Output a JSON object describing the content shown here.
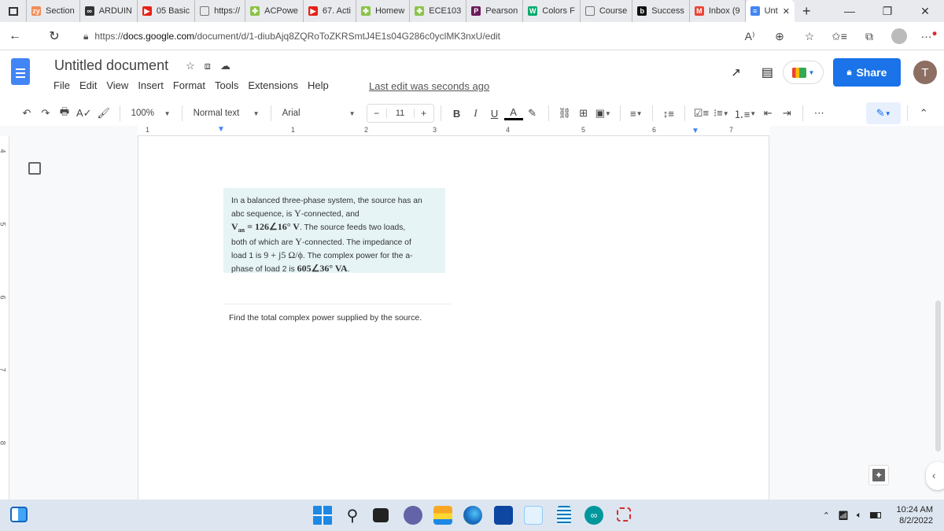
{
  "browser": {
    "tabs": [
      {
        "label": "Section",
        "icon": "zybooks-icon",
        "color": "#f28b57",
        "glyph": "zy"
      },
      {
        "label": "ARDUIN",
        "icon": "arduino-icon",
        "color": "#333333",
        "glyph": "∞"
      },
      {
        "label": "05 Basic",
        "icon": "youtube-icon",
        "color": "#e62117",
        "glyph": "▶"
      },
      {
        "label": "https://",
        "icon": "page-icon",
        "color": "#ffffff",
        "glyph": ""
      },
      {
        "label": "ACPowe",
        "icon": "chegg-icon",
        "color": "#8bc34a",
        "glyph": "✤"
      },
      {
        "label": "67. Acti",
        "icon": "youtube-icon",
        "color": "#e62117",
        "glyph": "▶"
      },
      {
        "label": "Homew",
        "icon": "chegg-icon",
        "color": "#8bc34a",
        "glyph": "✤"
      },
      {
        "label": "ECE103",
        "icon": "chegg-icon",
        "color": "#8bc34a",
        "glyph": "✤"
      },
      {
        "label": "Pearson",
        "icon": "pearson-icon",
        "color": "#6a1b5a",
        "glyph": "P"
      },
      {
        "label": "Colors F",
        "icon": "w3schools-icon",
        "color": "#04aa6d",
        "glyph": "W"
      },
      {
        "label": "Course",
        "icon": "course-icon",
        "color": "#888888",
        "glyph": ""
      },
      {
        "label": "Success",
        "icon": "bing-icon",
        "color": "#111111",
        "glyph": "b"
      },
      {
        "label": "Inbox (9",
        "icon": "gmail-icon",
        "color": "#ea4335",
        "glyph": "M"
      },
      {
        "label": "Unt",
        "icon": "docs-icon",
        "color": "#4285f4",
        "glyph": "≡",
        "active": true
      }
    ],
    "new_tab": "+",
    "url_prefix": "https://",
    "url_domain": "docs.google.com",
    "url_path": "/document/d/1-diubAjq8ZQRoToZKRSmtJ4E1s04G286c0yclMK3nxU/edit"
  },
  "docs": {
    "title": "Untitled document",
    "menu": [
      "File",
      "Edit",
      "View",
      "Insert",
      "Format",
      "Tools",
      "Extensions",
      "Help"
    ],
    "last_edit": "Last edit was seconds ago",
    "share_label": "Share",
    "user_initial": "T",
    "zoom": "100%",
    "style": "Normal text",
    "font": "Arial",
    "font_size": "11",
    "ruler_labels": [
      "1",
      "1",
      "2",
      "3",
      "4",
      "5",
      "6",
      "7"
    ],
    "vruler_labels": [
      "4",
      "5",
      "6",
      "7",
      "8"
    ]
  },
  "content": {
    "q1": "In a balanced three-phase system, the source has an",
    "q2a": "abc sequence, is ",
    "q2m": "Y",
    "q2b": "-connected, and",
    "q3m": "V",
    "q3sub": "an",
    "q3eq": " = 126∠16° V",
    "q3b": ". The source feeds two loads,",
    "q4a": "both of which are ",
    "q4m": "Y",
    "q4b": "-connected. The impedance of",
    "q5a": "load 1 is ",
    "q5m": "9 + j5 Ω/ϕ",
    "q5b": ". The complex power for the a-",
    "q6a": "phase of load 2 is ",
    "q6m": "605∠36° VA",
    "q6b": ".",
    "find": "Find the total complex power supplied by the source."
  },
  "taskbar": {
    "time": "10:24 AM",
    "date": "8/2/2022"
  }
}
